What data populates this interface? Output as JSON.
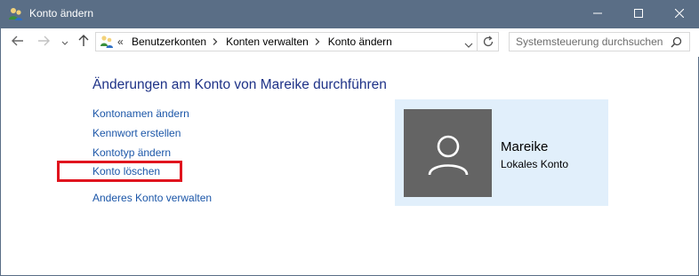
{
  "window": {
    "title": "Konto ändern",
    "title_icon": "user-accounts-icon",
    "controls": [
      "minimize-icon",
      "maximize-icon",
      "close-icon"
    ]
  },
  "nav": {
    "back_icon": "back-arrow-icon",
    "forward_icon": "forward-arrow-icon",
    "recent_icon": "chevron-down-icon",
    "up_icon": "up-arrow-icon"
  },
  "address": {
    "overflow": "«",
    "crumbs": [
      "Benutzerkonten",
      "Konten verwalten",
      "Konto ändern"
    ],
    "refresh_icon": "refresh-icon"
  },
  "search": {
    "placeholder": "Systemsteuerung durchsuchen",
    "icon": "search-icon"
  },
  "main": {
    "heading": "Änderungen am Konto von Mareike durchführen",
    "links": [
      "Kontonamen ändern",
      "Kennwort erstellen",
      "Kontotyp ändern",
      "Konto löschen",
      "Anderes Konto verwalten"
    ]
  },
  "account": {
    "name": "Mareike",
    "type": "Lokales Konto"
  },
  "colors": {
    "titlebar": "#5a6e86",
    "heading": "#1e3287",
    "link": "#1b56a8",
    "panel": "#e1effb",
    "avatar": "#646464",
    "highlight": "#e0141e"
  }
}
